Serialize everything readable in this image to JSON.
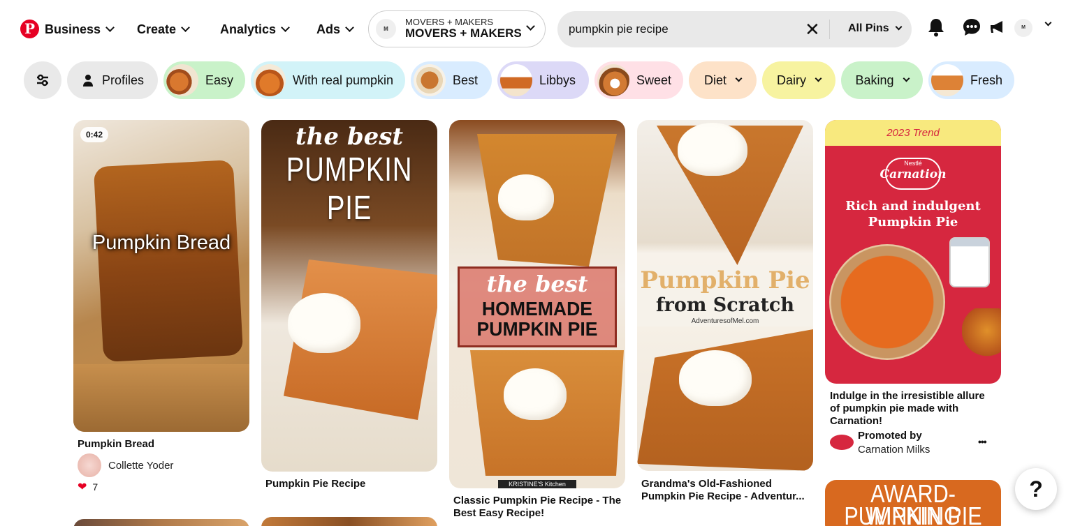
{
  "nav": {
    "logo": "P",
    "business": "Business",
    "create": "Create",
    "analytics": "Analytics",
    "ads": "Ads",
    "account": {
      "avatar": "M",
      "line1": "MOVERS + MAKERS",
      "line2": "MOVERS + MAKERS"
    },
    "search": {
      "value": "pumpkin pie recipe",
      "filter": "All Pins"
    },
    "user_avatar": "M"
  },
  "chips": {
    "settings": "settings-sliders-icon",
    "profiles": "Profiles",
    "easy": "Easy",
    "real": "With real pumpkin",
    "best": "Best",
    "libbys": "Libbys",
    "sweet": "Sweet",
    "diet": "Diet",
    "dairy": "Dairy",
    "baking": "Baking",
    "fresh": "Fresh"
  },
  "pins": [
    {
      "duration": "0:42",
      "overlay": "Pumpkin Bread",
      "title": "Pumpkin Bread",
      "author": "Collette Yoder",
      "reactions": "7"
    },
    {
      "overlay_top": "the best",
      "overlay_main": "PUMPKIN PIE",
      "title": "Pumpkin Pie Recipe"
    },
    {
      "overlay_top": "the best",
      "overlay_main1": "HOMEMADE",
      "overlay_main2": "PUMPKIN PIE",
      "footer": "KRISTINE'S Kitchen",
      "title": "Classic Pumpkin Pie Recipe - The Best Easy Recipe!"
    },
    {
      "overlay_main": "Pumpkin Pie",
      "overlay_sub": "from Scratch",
      "site": "AdventuresofMel.com",
      "title": "Grandma's Old-Fashioned Pumpkin Pie Recipe - Adventur..."
    },
    {
      "trend": "2023 Trend",
      "brand_top": "Nestlé",
      "brand": "Carnation",
      "headline1": "Rich and indulgent",
      "headline2": "Pumpkin Pie",
      "title": "Indulge in the irresistible allure of pumpkin pie made with Carnation!",
      "promoted": "Promoted by",
      "advertiser": "Carnation Milks",
      "more": "•••"
    },
    {
      "overlay1": "AWARD-WINNING",
      "overlay2": "PUMPKIN PIE"
    }
  ],
  "help": "?",
  "colors": {
    "pinterest_red": "#e60023",
    "pumpkin": "#c8742e"
  }
}
